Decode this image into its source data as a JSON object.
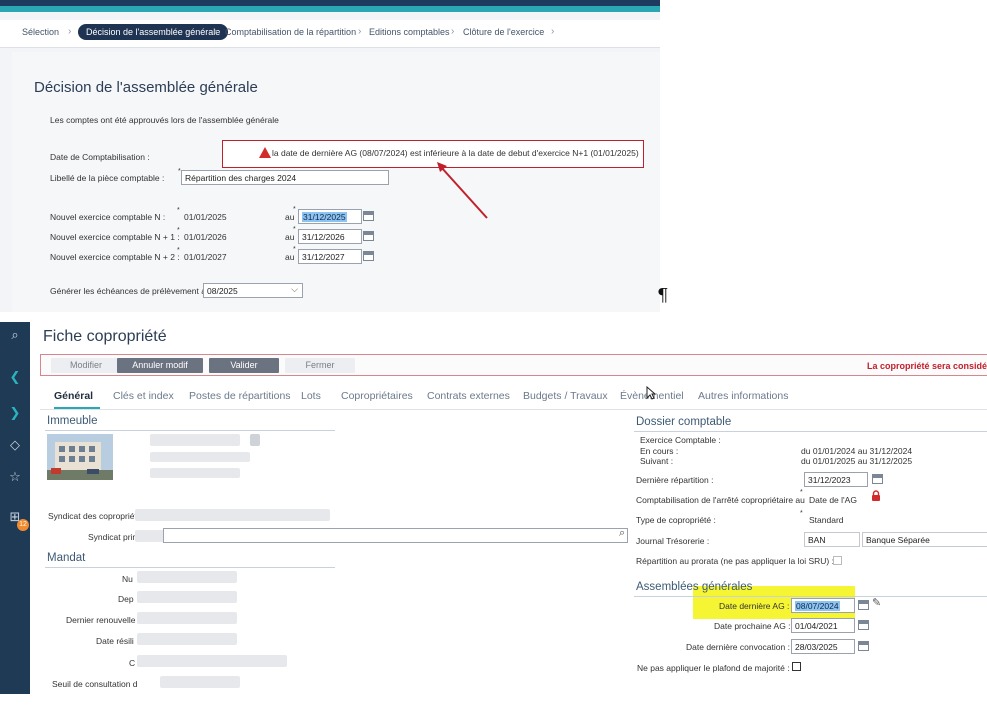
{
  "top": {
    "breadcrumb": [
      "Sélection",
      "Décision de l'assemblée générale",
      "Comptabilisation de la répartition",
      "Editions comptables",
      "Clôture de l'exercice"
    ],
    "title": "Décision de l'assemblée générale",
    "note": "Les comptes ont été approuvés lors de l'assemblée générale",
    "date_compta_label": "Date de Comptabilisation :",
    "warning": "la date de dernière AG (08/07/2024) est inférieure à la date de debut d'exercice N+1 (01/01/2025)",
    "libelle_label": "Libellé de la pièce comptable :",
    "libelle_value": "Répartition des charges 2024",
    "exercices": [
      {
        "label": "Nouvel exercice comptable N :",
        "start": "01/01/2025",
        "au": "au",
        "end": "31/12/2025"
      },
      {
        "label": "Nouvel exercice comptable N + 1 :",
        "start": "01/01/2026",
        "au": "au",
        "end": "31/12/2026"
      },
      {
        "label": "Nouvel exercice comptable N + 2 :",
        "start": "01/01/2027",
        "au": "au",
        "end": "31/12/2027"
      }
    ],
    "echeances_label": "Générer les échéances de prélèvement au",
    "echeances_value": "08/2025",
    "pilcrow": "¶"
  },
  "bottom": {
    "title": "Fiche copropriété",
    "toolbar": {
      "modifier": "Modifier",
      "annuler": "Annuler modif",
      "valider": "Valider",
      "fermer": "Fermer",
      "message": "La copropriété sera considé"
    },
    "tabs": [
      "Général",
      "Clés et index",
      "Postes de répartitions",
      "Lots",
      "Copropriétaires",
      "Contrats externes",
      "Budgets / Travaux",
      "Évènementiel",
      "Autres informations"
    ],
    "left": {
      "immeuble": "Immeuble",
      "syndicat_label": "Syndicat des copropriét",
      "syndicat_prin_label": "Syndicat prin",
      "mandat": "Mandat",
      "mandat_labels": [
        "Nu",
        "Dep",
        "Dernier renouvelle",
        "Date résili",
        "C",
        "Seuil de consultation d"
      ]
    },
    "right": {
      "dossier_title": "Dossier comptable",
      "exercice_label": "Exercice Comptable :",
      "en_cours_label": "En cours :",
      "en_cours_value": "du 01/01/2024 au 31/12/2024",
      "suivant_label": "Suivant :",
      "suivant_value": "du 01/01/2025 au 31/12/2025",
      "derniere_repartition_label": "Dernière répartition :",
      "derniere_repartition_value": "31/12/2023",
      "compta_arrete_label": "Comptabilisation de l'arrêté copropriétaire au",
      "compta_arrete_value": "Date de l'AG",
      "type_label": "Type de copropriété :",
      "type_value": "Standard",
      "journal_label": "Journal Trésorerie :",
      "journal_code": "BAN",
      "journal_name": "Banque Séparée",
      "prorata_label": "Répartition au prorata (ne pas appliquer la loi SRU) :",
      "ag_title": "Assemblées générales",
      "derniere_ag_label": "Date dernière AG :",
      "derniere_ag_value": "08/07/2024",
      "prochaine_ag_label": "Date prochaine AG :",
      "prochaine_ag_value": "01/04/2021",
      "derniere_convocation_label": "Date dernière convocation :",
      "derniere_convocation_value": "28/03/2025",
      "plafond_label": "Ne pas appliquer le plafond de majorité :"
    },
    "rail_badge": "12"
  },
  "colors": {
    "accent": "#2aa7b5",
    "navy": "#1f3a55",
    "warning_red": "#c0202c",
    "highlight": "#f6f534"
  }
}
